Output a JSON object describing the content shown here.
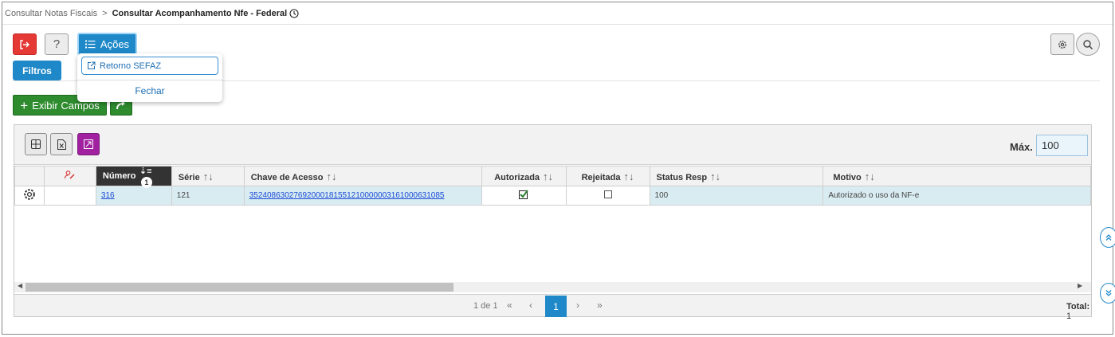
{
  "breadcrumb": {
    "parent": "Consultar Notas Fiscais",
    "separator": ">",
    "current": "Consultar Acompanhamento Nfe - Federal"
  },
  "toolbar": {
    "help_label": "?",
    "acoes_label": "Ações",
    "filtros_label": "Filtros",
    "exibir_campos_label": "Exibir Campos"
  },
  "acoes_menu": {
    "items": [
      {
        "label": "Retorno SEFAZ"
      }
    ],
    "close_label": "Fechar"
  },
  "grid": {
    "max_label": "Máx.",
    "max_value": "100",
    "columns": {
      "numero": "Número",
      "numero_sort_order": "1",
      "serie": "Série",
      "chave": "Chave de Acesso",
      "autorizada": "Autorizada",
      "rejeitada": "Rejeitada",
      "status": "Status Resp",
      "motivo": "Motivo"
    },
    "rows": [
      {
        "numero": "316",
        "serie": "121",
        "chave": "35240863027692000181551210000003161000631085",
        "autorizada": true,
        "rejeitada": false,
        "status": "100",
        "motivo": "Autorizado o uso da NF-e"
      }
    ]
  },
  "pager": {
    "info": "1 de 1",
    "current_page": "1",
    "total_label": "Total:",
    "total_value": "1"
  },
  "colors": {
    "primary": "#1e88c8",
    "danger": "#e53935",
    "success": "#2e8b2e",
    "purple": "#a020a0",
    "row_highlight": "#d9ecf2"
  }
}
